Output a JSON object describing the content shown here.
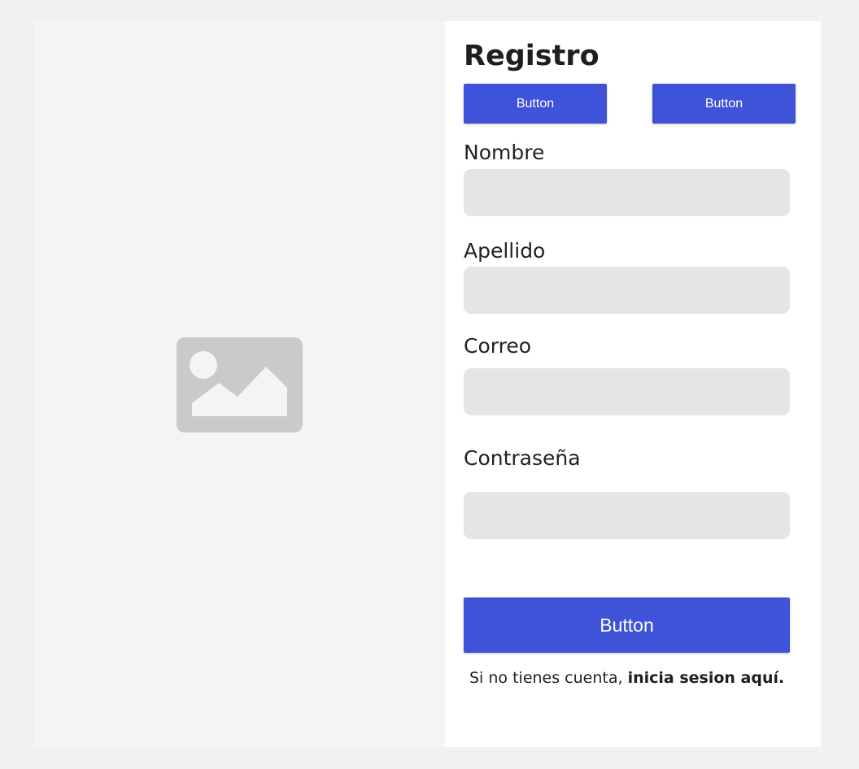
{
  "form": {
    "title": "Registro",
    "top_buttons": [
      {
        "label": "Button"
      },
      {
        "label": "Button"
      }
    ],
    "fields": {
      "nombre": {
        "label": "Nombre",
        "value": "",
        "placeholder": ""
      },
      "apellido": {
        "label": "Apellido",
        "value": "",
        "placeholder": ""
      },
      "correo": {
        "label": "Correo",
        "value": "",
        "placeholder": ""
      },
      "contrasena": {
        "label": "Contraseña",
        "value": "",
        "placeholder": ""
      }
    },
    "submit_label": "Button",
    "footer": {
      "text": "Si no tienes cuenta, ",
      "link_text": "inicia sesion aquí."
    }
  },
  "image_panel": {
    "icon": "image-placeholder-icon"
  },
  "colors": {
    "accent": "#3f53d9",
    "field_background": "#e5e5e5",
    "page_background": "#f1f1f1",
    "image_panel_background": "#f4f4f4",
    "icon_gray": "#cacaca"
  }
}
